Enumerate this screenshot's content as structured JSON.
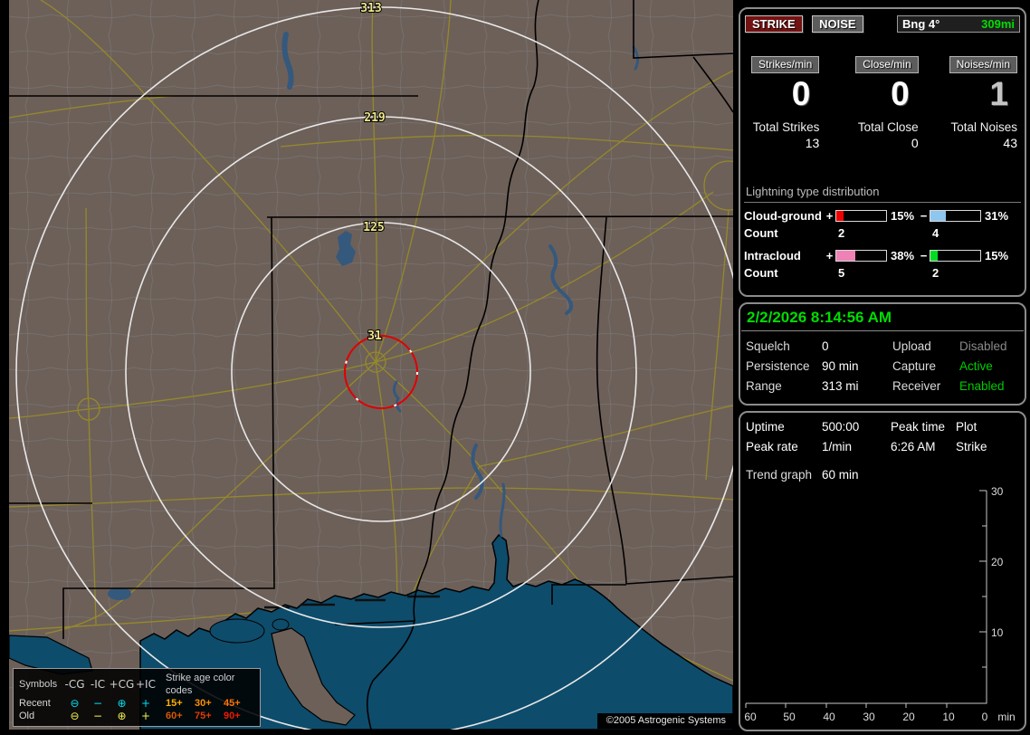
{
  "map": {
    "rings": [
      "313",
      "219",
      "125",
      "31"
    ],
    "copyright": "©2005 Astrogenic Systems",
    "legend": {
      "symbols_label": "Symbols",
      "col_headers": [
        "-CG",
        "-IC",
        "+CG",
        "+IC"
      ],
      "age_header": "Strike age color codes",
      "glyphs": {
        "circ_minus": "⊖",
        "minus": "−",
        "circ_plus": "⊕",
        "plus": "+"
      },
      "recent": {
        "label": "Recent",
        "symbol_color": "#00e0f0",
        "ages": [
          {
            "text": "15+",
            "color": "#ffb000"
          },
          {
            "text": "30+",
            "color": "#ff9000"
          },
          {
            "text": "45+",
            "color": "#ff7400"
          }
        ]
      },
      "old": {
        "label": "Old",
        "symbol_color": "#f0f050",
        "ages": [
          {
            "text": "60+",
            "color": "#d85800"
          },
          {
            "text": "75+",
            "color": "#e03c00"
          },
          {
            "text": "90+",
            "color": "#ee1800"
          }
        ]
      }
    }
  },
  "header": {
    "strike_button": "STRIKE",
    "noise_button": "NOISE",
    "bearing_label": "Bng 4°",
    "bearing_range": "309mi",
    "bearing_range_color": "#00dd00"
  },
  "stats": {
    "columns": [
      {
        "rate_label": "Strikes/min",
        "rate": "0",
        "rate_color": "#ffffff",
        "total_label": "Total Strikes",
        "total": "13"
      },
      {
        "rate_label": "Close/min",
        "rate": "0",
        "rate_color": "#ffffff",
        "total_label": "Total Close",
        "total": "0"
      },
      {
        "rate_label": "Noises/min",
        "rate": "1",
        "rate_color": "#c4c4c4",
        "total_label": "Total Noises",
        "total": "43"
      }
    ],
    "distribution": {
      "title": "Lightning type distribution",
      "plus_sign": "+",
      "minus_sign": "−",
      "count_label": "Count",
      "rows": [
        {
          "label": "Cloud-ground",
          "pos_pct": "15%",
          "pos_color": "#f00000",
          "pos_count": "2",
          "neg_pct": "31%",
          "neg_color": "#8ec6f0",
          "neg_count": "4"
        },
        {
          "label": "Intracloud",
          "pos_pct": "38%",
          "pos_color": "#ee82b4",
          "pos_count": "5",
          "neg_pct": "15%",
          "neg_color": "#00dd22",
          "neg_count": "2"
        }
      ]
    }
  },
  "status": {
    "datetime": "2/2/2026 8:14:56 AM",
    "datetime_color": "#00dd00",
    "rows": [
      {
        "l1": "Squelch",
        "v1": "0",
        "l2": "Upload",
        "v2": "Disabled",
        "v2_color": "#8a8a8a"
      },
      {
        "l1": "Persistence",
        "v1": "90 min",
        "l2": "Capture",
        "v2": "Active",
        "v2_color": "#00cc00"
      },
      {
        "l1": "Range",
        "v1": "313 mi",
        "l2": "Receiver",
        "v2": "Enabled",
        "v2_color": "#00cc00"
      }
    ]
  },
  "trend": {
    "uptime_label": "Uptime",
    "uptime": "500:00",
    "peak_time_label": "Peak time",
    "plot_label": "Plot",
    "peak_rate_label": "Peak rate",
    "peak_rate": "1/min",
    "peak_time": "6:26 AM",
    "plot_mode": "Strike",
    "trend_label": "Trend graph",
    "trend_window": "60 min",
    "chart": {
      "y_ticks": [
        "30",
        "20",
        "10"
      ],
      "x_ticks": [
        "60",
        "50",
        "40",
        "30",
        "20",
        "10",
        "0"
      ],
      "x_unit": "min"
    }
  },
  "chart_data": {
    "type": "line",
    "title": "Strike trend graph (last 60 min)",
    "xlabel": "min",
    "x_ticks": [
      60,
      50,
      40,
      30,
      20,
      10,
      0
    ],
    "ylim": [
      0,
      30
    ],
    "y_ticks": [
      30,
      20,
      10
    ],
    "series": [],
    "legend_position": "none",
    "grid": false
  }
}
